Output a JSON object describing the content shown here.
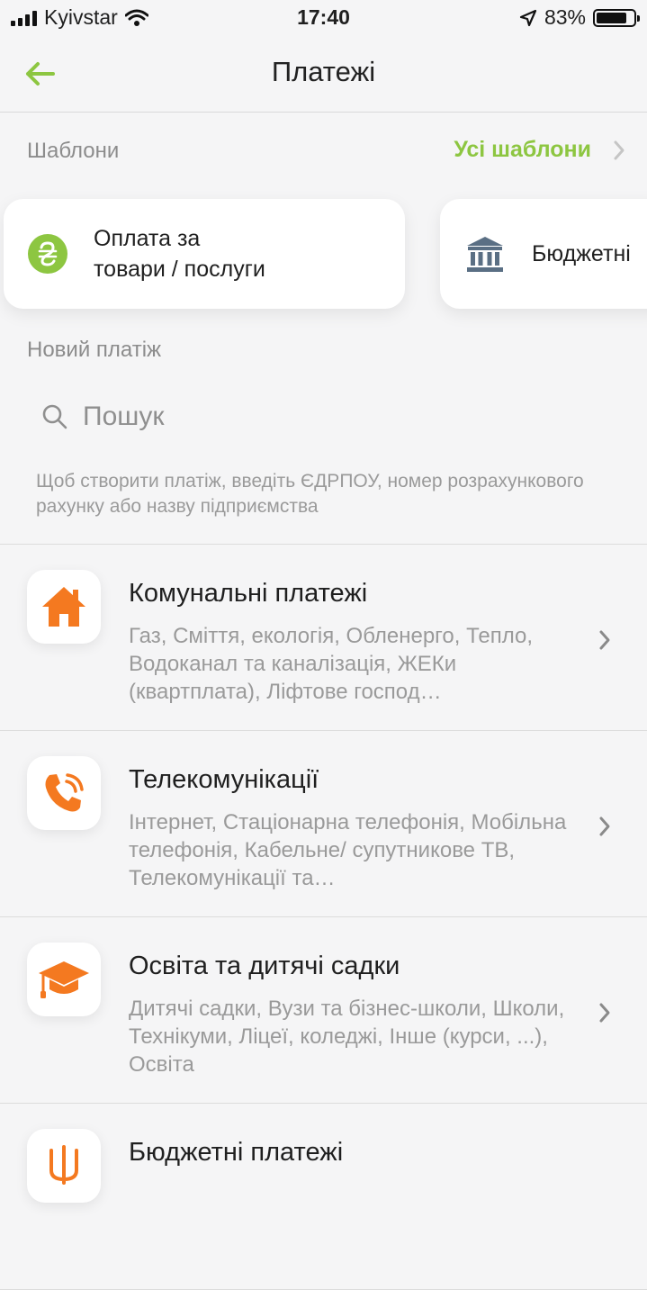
{
  "status_bar": {
    "carrier": "Kyivstar",
    "time": "17:40",
    "battery": "83%",
    "battery_level": 0.83
  },
  "nav": {
    "title": "Платежі"
  },
  "templates": {
    "label": "Шаблони",
    "all_label": "Усі шаблони",
    "cards": [
      {
        "line1": "Оплата за",
        "line2": "товари / послуги"
      },
      {
        "line1": "Бюджетні"
      }
    ]
  },
  "new_payment": {
    "label": "Новий платіж",
    "search_placeholder": "Пошук",
    "hint": "Щоб створити платіж, введіть ЄДРПОУ, номер розрахункового рахунку або назву підприємства"
  },
  "categories": [
    {
      "title": "Комунальні платежі",
      "desc": "Газ, Сміття, екологія, Обленерго, Тепло, Водоканал та каналізація, ЖЕКи (квартплата), Ліфтове господ…",
      "icon": "house-icon"
    },
    {
      "title": "Телекомунікації",
      "desc": "Інтернет, Стаціонарна телефонія, Мобільна телефонія, Кабельне/ супутникове ТВ, Телекомунікації та…",
      "icon": "phone-icon"
    },
    {
      "title": "Освіта та дитячі садки",
      "desc": "Дитячі садки, Вузи та бізнес-школи, Школи, Технікуми, Ліцеї, коледжі, Інше (курси, ...), Освіта",
      "icon": "graduation-cap-icon"
    },
    {
      "title": "Бюджетні платежі",
      "icon": "trident-icon"
    }
  ],
  "colors": {
    "accent_green": "#8dc641",
    "accent_orange": "#f47920",
    "bank_icon": "#5a6f84"
  }
}
